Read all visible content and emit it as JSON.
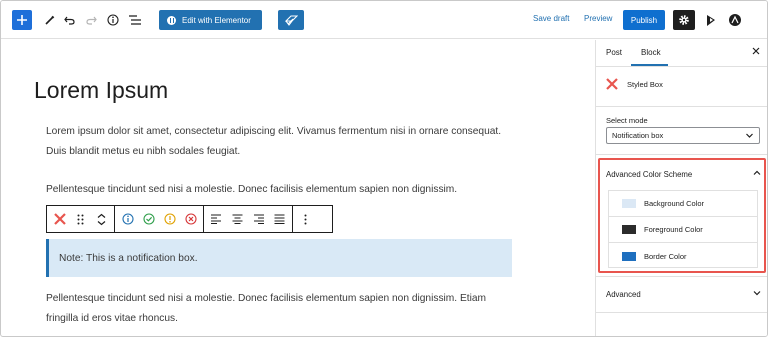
{
  "toolbar": {
    "edit_with_elementor": "Edit with Elementor",
    "save_draft": "Save draft",
    "preview": "Preview",
    "publish": "Publish",
    "icons": [
      "add-block-icon",
      "pencil-tools-icon",
      "undo-icon",
      "redo-icon",
      "info-icon",
      "list-view-icon",
      "elementor-icon",
      "kit-icon",
      "settings-gear-icon",
      "jetpack-icon",
      "astra-icon"
    ]
  },
  "editor": {
    "title": "Lorem Ipsum",
    "paragraph1": "Lorem ipsum dolor sit amet, consectetur adipiscing elit. Vivamus fermentum nisi in ornare consequat. Duis blandit metus eu nibh sodales feugiat.",
    "paragraph2": "Pellentesque tincidunt sed nisi a molestie. Donec facilisis elementum sapien non dignissim.",
    "notice": "Note: This is a notification box.",
    "paragraph3": "Pellentesque tincidunt sed nisi a molestie. Donec facilisis elementum sapien non dignissim. Etiam fringilla id eros vitae rhoncus."
  },
  "sidebar": {
    "tabs": [
      "Post",
      "Block"
    ],
    "active_tab": "Block",
    "block_name": "Styled Box",
    "select_mode_label": "Select mode",
    "select_mode_value": "Notification box",
    "color_panel_title": "Advanced Color Scheme",
    "colors": [
      {
        "label": "Background Color",
        "hex": "#dbe8f5"
      },
      {
        "label": "Foreground Color",
        "hex": "#2b2b2b"
      },
      {
        "label": "Border Color",
        "hex": "#1e6fbf"
      }
    ],
    "advanced_title": "Advanced"
  },
  "theme": {
    "accent": "#2271b1",
    "highlight": "#e8554e"
  }
}
